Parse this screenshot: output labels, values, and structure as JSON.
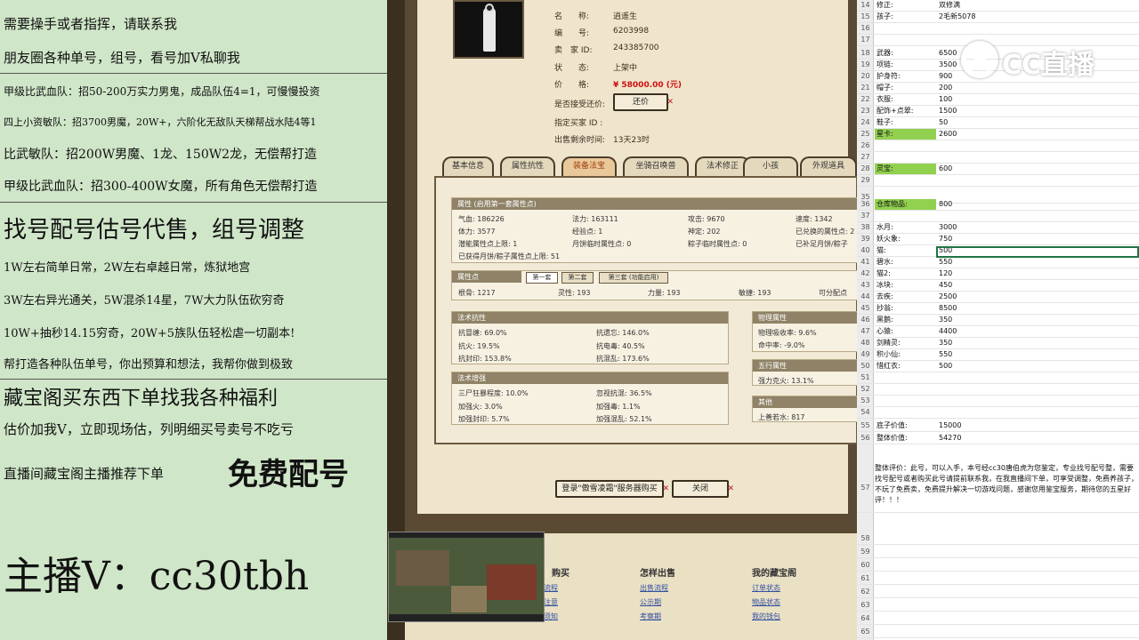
{
  "left": {
    "lines": [
      "需要操手或者指挥，请联系我",
      "朋友圈各种单号，组号，看号加V私聊我",
      "甲级比武血队：招50-200万实力男鬼，成品队伍4=1，可慢慢投资",
      "四上小资敏队：招3700男魔，20W+，六阶化无敌队天梯帮战水陆4等1",
      "比武敏队：招200W男魔、1龙、150W2龙，无偿帮打造",
      "甲级比武血队：招300-400W女魔，所有角色无偿帮打造",
      "找号配号估号代售，组号调整",
      "1W左右简单日常，2W左右卓越日常，炼狱地宫",
      "3W左右异光通关，5W混杀14星，7W大力队伍砍穷奇",
      "10W+抽秒14.15穷奇，20W+5族队伍轻松虐一切副本!",
      "帮打造各种队伍单号，你出预算和想法，我帮你做到极致",
      "藏宝阁买东西下单找我各种福利",
      "估价加我V，立即现场估，列明细买号卖号不吃亏",
      "直播间藏宝阁主播推荐下单",
      "免费配号",
      "主播V：cc30tbh"
    ]
  },
  "game": {
    "info": [
      {
        "label": "名　　称:",
        "value": "逍遥生"
      },
      {
        "label": "编　　号:",
        "value": "6203998"
      },
      {
        "label": "卖　家 ID:",
        "value": "243385700"
      },
      {
        "label": "状　　态:",
        "value": "上架中"
      },
      {
        "label": "价　　格:",
        "value": "¥ 58000.00 (元)"
      }
    ],
    "bargain_label": "是否接受还价:",
    "bargain_button": "还价",
    "buyer_label": "指定买家 ID :",
    "remain_label": "出售剩余时间:",
    "remain_value": "13天23时",
    "tabs": [
      "基本信息",
      "属性抗性",
      "装备法宝",
      "坐骑召唤兽",
      "法术修正",
      "小孩",
      "外观道具"
    ],
    "attr_header": "属性 (启用第一套属性点)",
    "attr_rows": [
      [
        "气血: 186226",
        "法力: 163111",
        "攻击: 9670",
        "速度: 1342"
      ],
      [
        "体力: 3577",
        "经验点: 1",
        "神定: 202",
        "已兑换的属性点: 2"
      ],
      [
        "潜能属性点上限: 1",
        "月饼临时属性点: 0",
        "粽子临时属性点: 0",
        "已补足月饼/粽子"
      ],
      [
        "已获得月饼/粽子属性点上限: 51",
        "",
        "",
        ""
      ]
    ],
    "points_header": "属性点",
    "subtabs": [
      "第一套",
      "第二套",
      "第三套 (功能启用)"
    ],
    "points_row": [
      "根骨: 1217",
      "灵性: 193",
      "力量: 193",
      "敏捷: 193",
      "可分配点"
    ],
    "resist_header": "法术抗性",
    "resist": [
      [
        "抗冒缠: 69.0%",
        "抗遗忘: 146.0%"
      ],
      [
        "抗火: 19.5%",
        "抗电毒: 40.5%"
      ],
      [
        "抗封印: 153.8%",
        "抗混乱: 173.6%"
      ]
    ],
    "boost_header": "法术增强",
    "boost": [
      [
        "三尸狂暴程度: 10.0%",
        "忽视抗混: 36.5%"
      ],
      [
        "加强火: 3.0%",
        "加强毒: 1.1%"
      ],
      [
        "加强封印: 5.7%",
        "加强混乱: 52.1%"
      ]
    ],
    "phys_header": "物理属性",
    "phys": [
      "物理吸收率: 9.6%",
      "命中率: -9.0%"
    ],
    "five_header": "五行属性",
    "five": [
      "强力克火: 13.1%"
    ],
    "other_header": "其他",
    "other": [
      "上善若水: 817"
    ],
    "login_button": "登录\"傲雪凌霜\"服务器购买",
    "close_button": "关闭",
    "footer": {
      "col1_title": "购买",
      "col1_links": [
        "流程",
        "注意",
        "须知"
      ],
      "col2_title": "怎样出售",
      "col2_links": [
        "出售流程",
        "公示期",
        "考察期"
      ],
      "col3_title": "我的藏宝阁",
      "col3_links": [
        "订单状态",
        "物品状态",
        "我的钱包"
      ]
    }
  },
  "sheet": {
    "rows": [
      {
        "n": "14",
        "a": "修正:",
        "b": "双修满"
      },
      {
        "n": "15",
        "a": "孩子:",
        "b": "2毛新5078"
      },
      {
        "n": "16",
        "a": "",
        "b": ""
      },
      {
        "n": "17",
        "a": "",
        "b": ""
      },
      {
        "n": "18",
        "a": "武器:",
        "b": "6500"
      },
      {
        "n": "19",
        "a": "项链:",
        "b": "3500"
      },
      {
        "n": "20",
        "a": "护身符:",
        "b": "900"
      },
      {
        "n": "21",
        "a": "帽子:",
        "b": "200"
      },
      {
        "n": "22",
        "a": "衣服:",
        "b": "100"
      },
      {
        "n": "23",
        "a": "配饰+点翠:",
        "b": "1500"
      },
      {
        "n": "24",
        "a": "鞋子:",
        "b": "50"
      },
      {
        "n": "25",
        "a": "星卡:",
        "b": "2600",
        "green": true
      },
      {
        "n": "26",
        "a": "",
        "b": ""
      },
      {
        "n": "27",
        "a": "",
        "b": ""
      },
      {
        "n": "28",
        "a": "灵宝:",
        "b": "600",
        "green": true
      },
      {
        "n": "29",
        "a": "",
        "b": ""
      },
      {
        "n": "35",
        "a": "",
        "b": ""
      },
      {
        "n": "36",
        "a": "仓库物品:",
        "b": "800",
        "green": true
      },
      {
        "n": "37",
        "a": "",
        "b": ""
      },
      {
        "n": "38",
        "a": "水月:",
        "b": "3000"
      },
      {
        "n": "39",
        "a": "妖火象:",
        "b": "750"
      },
      {
        "n": "40",
        "a": "猫:",
        "b": "500"
      },
      {
        "n": "41",
        "a": "碧水:",
        "b": "550"
      },
      {
        "n": "42",
        "a": "猫2:",
        "b": "120"
      },
      {
        "n": "43",
        "a": "冰块:",
        "b": "450"
      },
      {
        "n": "44",
        "a": "去疾:",
        "b": "2500"
      },
      {
        "n": "45",
        "a": "抄翁:",
        "b": "8500"
      },
      {
        "n": "46",
        "a": "黑鹅:",
        "b": "350"
      },
      {
        "n": "47",
        "a": "心猿:",
        "b": "4400"
      },
      {
        "n": "48",
        "a": "剑精灵:",
        "b": "350"
      },
      {
        "n": "49",
        "a": "积小仙:",
        "b": "550"
      },
      {
        "n": "50",
        "a": "惜红衣:",
        "b": "500"
      },
      {
        "n": "51",
        "a": "",
        "b": ""
      },
      {
        "n": "52",
        "a": "",
        "b": ""
      },
      {
        "n": "53",
        "a": "",
        "b": ""
      },
      {
        "n": "54",
        "a": "",
        "b": ""
      },
      {
        "n": "55",
        "a": "底子价值:",
        "b": "15000"
      },
      {
        "n": "56",
        "a": "整体价值:",
        "b": "54270"
      }
    ],
    "note_row": "57",
    "note": "整体评价：此号，可以入手，本号经cc30唐伯虎为您鉴定，专业找号配号整，需要找号配号或者购买此号请提前联系我，在我直播间下单，可享受调整，免费养孩子，不玩了免费卖，免费提升解决一切游戏问题，感谢您用鉴宝服务，期待您的五星好评！！！",
    "tail_rows": [
      "58",
      "59",
      "60",
      "61",
      "62",
      "63",
      "64",
      "65"
    ]
  },
  "logo_text": "CC直播"
}
